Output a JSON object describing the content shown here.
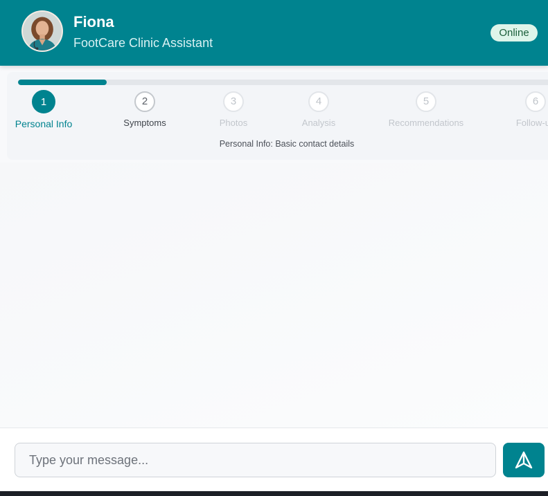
{
  "header": {
    "agent_name": "Fiona",
    "agent_role": "FootCare Clinic Assistant",
    "status": "Online",
    "avatar_icon": "doctor-avatar-photo"
  },
  "progress": {
    "current_step": 1,
    "fill_fraction": 0.16,
    "description": "Personal Info: Basic contact details",
    "steps": [
      {
        "number": "1",
        "label": "Personal Info"
      },
      {
        "number": "2",
        "label": "Symptoms"
      },
      {
        "number": "3",
        "label": "Photos"
      },
      {
        "number": "4",
        "label": "Analysis"
      },
      {
        "number": "5",
        "label": "Recommendations"
      },
      {
        "number": "6",
        "label": "Follow-up"
      }
    ]
  },
  "composer": {
    "placeholder": "Type your message...",
    "send_icon": "send-arrow-icon"
  },
  "colors": {
    "brand": "#00838f",
    "online_bg": "#dff5ea",
    "online_text": "#1b5e3a"
  }
}
